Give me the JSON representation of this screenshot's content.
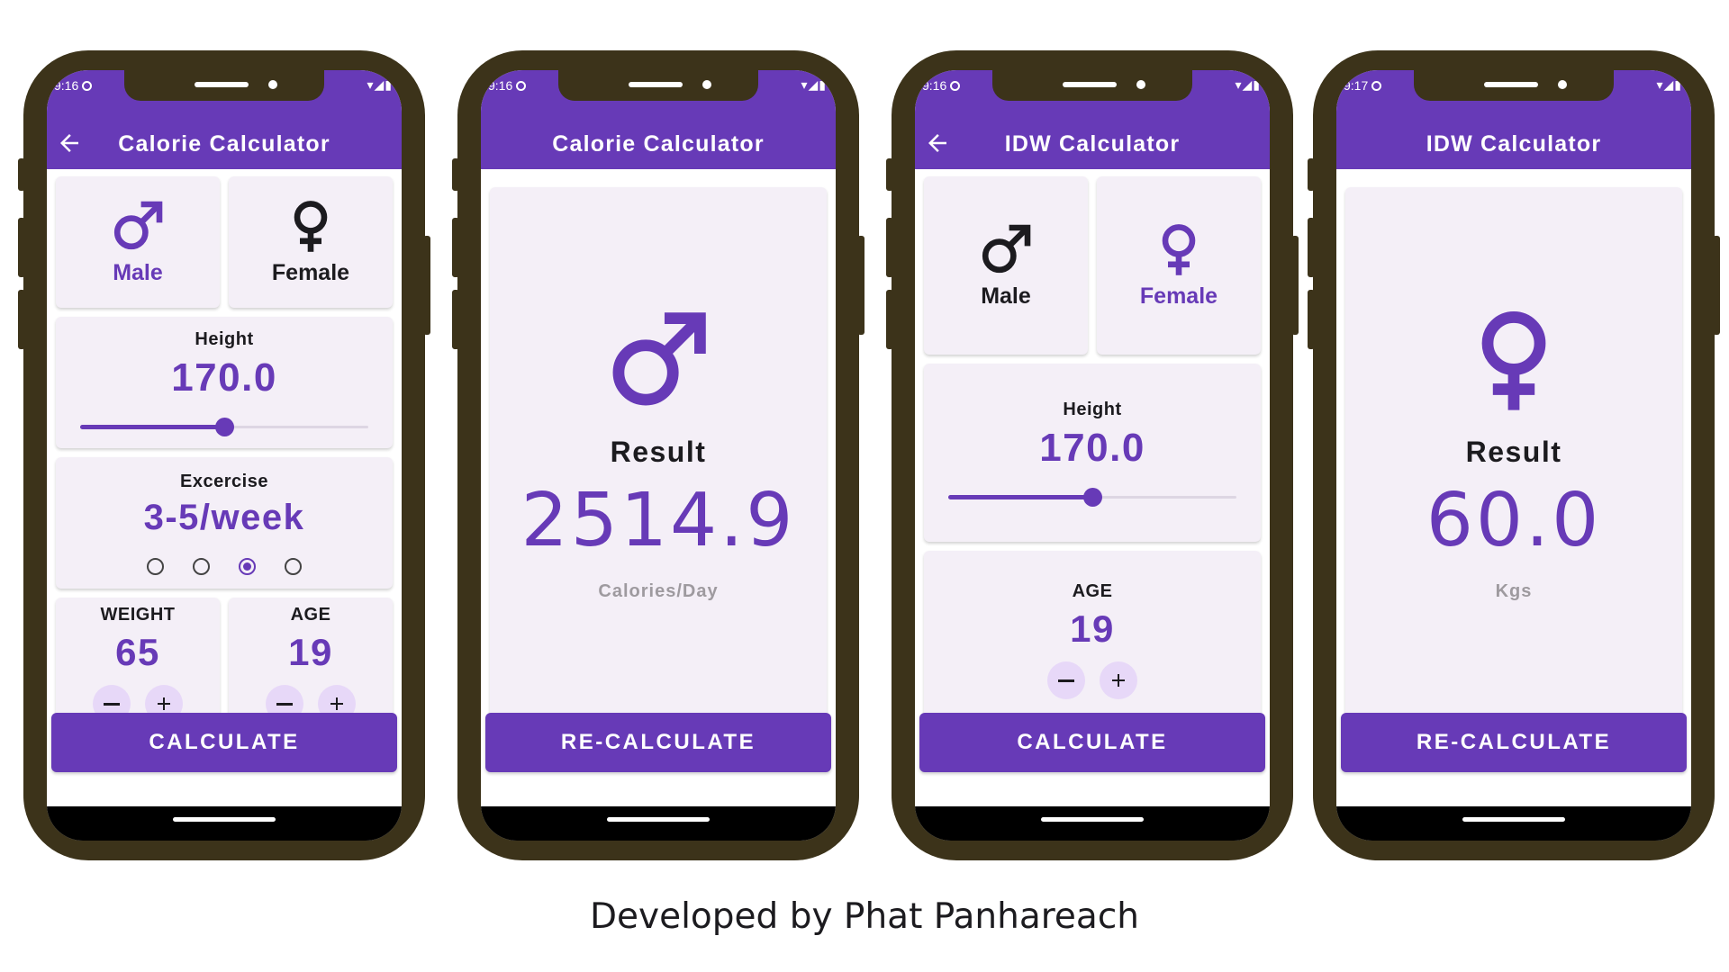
{
  "colors": {
    "primary": "#673ab7",
    "frame": "#3c331a",
    "card": "#f4eff7",
    "stepper": "#e7d8f8",
    "muted": "#9e9a9f"
  },
  "phones": [
    {
      "status": {
        "time": "9:16"
      },
      "title": "Calorie Calculator",
      "has_back": true,
      "gender": {
        "male": "Male",
        "female": "Female",
        "selected": "male"
      },
      "height": {
        "label": "Height",
        "value": "170.0",
        "slider_fraction": 0.5
      },
      "exercise": {
        "label": "Excercise",
        "value": "3-5/week",
        "selected_index": 2,
        "options": 4
      },
      "weight": {
        "label": "WEIGHT",
        "value": "65"
      },
      "age": {
        "label": "AGE",
        "value": "19"
      },
      "button": "CALCULATE"
    },
    {
      "status": {
        "time": "9:16"
      },
      "title": "Calorie Calculator",
      "has_back": false,
      "result": {
        "icon": "male-icon",
        "label": "Result",
        "value": "2514.9",
        "unit": "Calories/Day"
      },
      "button": "RE-CALCULATE"
    },
    {
      "status": {
        "time": "9:16"
      },
      "title": "IDW Calculator",
      "has_back": true,
      "gender": {
        "male": "Male",
        "female": "Female",
        "selected": "female"
      },
      "height": {
        "label": "Height",
        "value": "170.0",
        "slider_fraction": 0.5
      },
      "age": {
        "label": "AGE",
        "value": "19"
      },
      "button": "CALCULATE"
    },
    {
      "status": {
        "time": "9:17"
      },
      "title": "IDW Calculator",
      "has_back": false,
      "result": {
        "icon": "female-icon",
        "label": "Result",
        "value": "60.0",
        "unit": "Kgs"
      },
      "button": "RE-CALCULATE"
    }
  ],
  "caption": "Developed by Phat Panhareach"
}
